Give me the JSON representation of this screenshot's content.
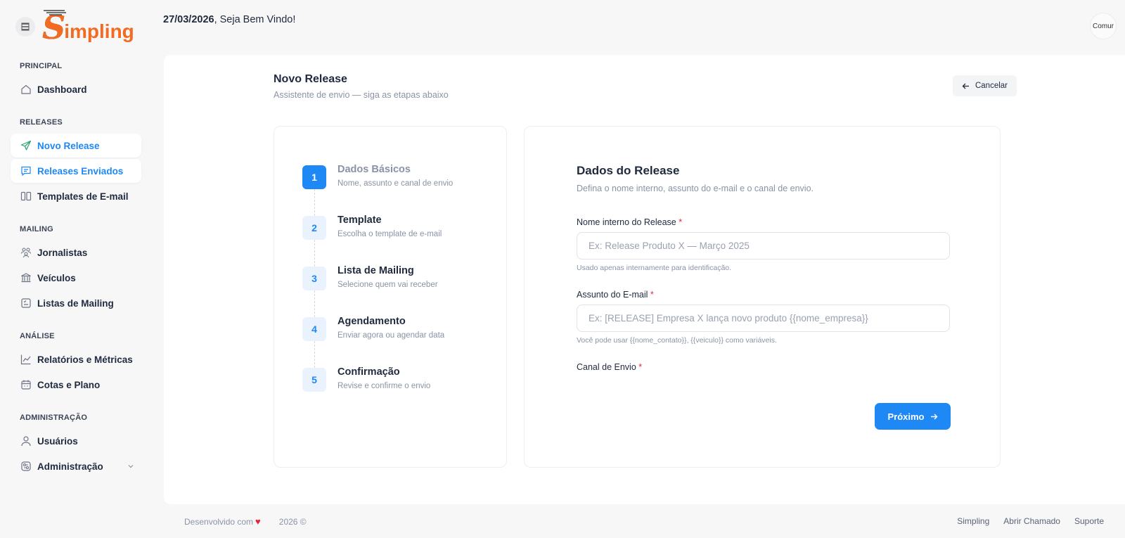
{
  "header": {
    "date": "27/03/2026",
    "greeting": ", Seja Bem Vindo!",
    "avatar_alt": "Comur"
  },
  "brand": {
    "logo_letter": "S",
    "logo_rest": "impling",
    "color": "#f36b21"
  },
  "sidebar": {
    "sections": [
      {
        "label": "PRINCIPAL"
      },
      {
        "label": "RELEASES"
      },
      {
        "label": "MAILING"
      },
      {
        "label": "ANÁLISE"
      },
      {
        "label": "ADMINISTRAÇÃO"
      }
    ],
    "items": [
      {
        "label": "Dashboard",
        "icon": "home-icon"
      },
      {
        "label": "Novo Release",
        "icon": "send-icon",
        "active": true
      },
      {
        "label": "Releases Enviados",
        "icon": "message-icon",
        "active": true
      },
      {
        "label": "Templates de E-mail",
        "icon": "columns-icon"
      },
      {
        "label": "Jornalistas",
        "icon": "users-icon"
      },
      {
        "label": "Veículos",
        "icon": "building-icon"
      },
      {
        "label": "Listas de Mailing",
        "icon": "list-icon"
      },
      {
        "label": "Relatórios e Métricas",
        "icon": "chart-line-icon"
      },
      {
        "label": "Cotas e Plano",
        "icon": "calendar-icon"
      },
      {
        "label": "Usuários",
        "icon": "user-icon"
      },
      {
        "label": "Administração",
        "icon": "settings-icon"
      }
    ]
  },
  "page": {
    "title": "Novo Release",
    "subtitle": "Assistente de envio — siga as etapas abaixo",
    "cancel_label": "Cancelar"
  },
  "steps": [
    {
      "num": "1",
      "title": "Dados Básicos",
      "desc": "Nome, assunto e canal de envio",
      "active": true
    },
    {
      "num": "2",
      "title": "Template",
      "desc": "Escolha o template de e-mail"
    },
    {
      "num": "3",
      "title": "Lista de Mailing",
      "desc": "Selecione quem vai receber"
    },
    {
      "num": "4",
      "title": "Agendamento",
      "desc": "Enviar agora ou agendar data"
    },
    {
      "num": "5",
      "title": "Confirmação",
      "desc": "Revise e confirme o envio"
    }
  ],
  "form": {
    "title": "Dados do Release",
    "subtitle": "Defina o nome interno, assunto do e-mail e o canal de envio.",
    "name_label": "Nome interno do Release",
    "name_placeholder": "Ex: Release Produto X — Março 2025",
    "name_value": "",
    "name_help": "Usado apenas internamente para identificação.",
    "subject_label": "Assunto do E-mail",
    "subject_placeholder": "Ex: [RELEASE] Empresa X lança novo produto {{nome_empresa}}",
    "subject_value": "",
    "subject_help": "Você pode usar {{nome_contato}}, {{veiculo}} como variáveis.",
    "channel_label": "Canal de Envio",
    "required_mark": "*",
    "next_label": "Próximo"
  },
  "footer": {
    "left_text": "Desenvolvido com",
    "heart": "♥",
    "year": "2026 ©",
    "links": [
      "Simpling",
      "Abrir Chamado",
      "Suporte"
    ]
  },
  "colors": {
    "accent": "#1e88f5",
    "brand": "#f36b21",
    "required": "#e5243b"
  }
}
